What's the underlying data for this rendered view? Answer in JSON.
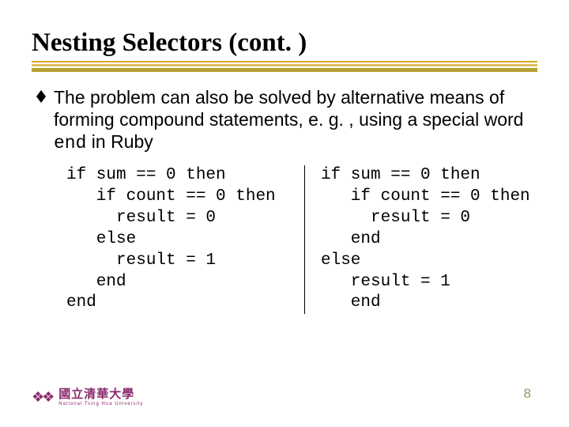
{
  "title": "Nesting Selectors (cont. )",
  "bullet": {
    "text_before_code": "The problem can also be solved by alternative means of forming compound statements, e. g. , using a special word ",
    "code_word": "end",
    "text_after_code": " in Ruby"
  },
  "code_left": "if sum == 0 then\n   if count == 0 then\n     result = 0\n   else\n     result = 1\n   end\nend",
  "code_right": "if sum == 0 then\n   if count == 0 then\n     result = 0\n   end\nelse\n   result = 1\n   end",
  "footer": {
    "cn": "國立清華大學",
    "en": "National Tsing Hua University"
  },
  "page_number": "8"
}
